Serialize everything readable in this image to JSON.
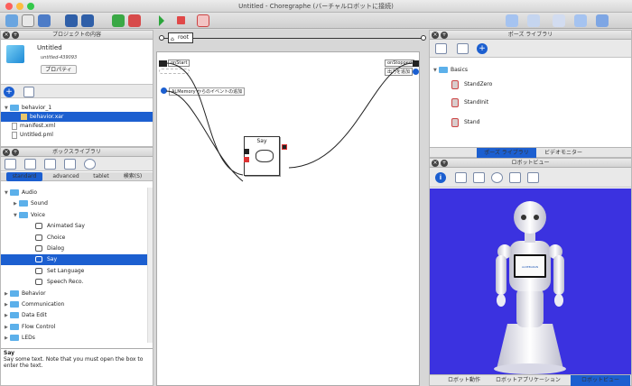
{
  "window": {
    "title": "Untitled - Choregraphe (バーチャルロボットに接続)"
  },
  "project": {
    "header": "プロジェクトの内容",
    "name": "Untitled",
    "id": "untitled-439093",
    "properties_button": "プロパティ",
    "files": [
      "behavior_1",
      "behavior.xar",
      "manifest.xml",
      "Untitled.pml"
    ]
  },
  "library": {
    "header": "ボックスライブラリ",
    "tabs": [
      "standard",
      "advanced",
      "tablet",
      "検索(S)"
    ],
    "items": [
      {
        "label": "Audio",
        "level": 0,
        "open": true
      },
      {
        "label": "Sound",
        "level": 1,
        "open": false
      },
      {
        "label": "Voice",
        "level": 1,
        "open": true
      },
      {
        "label": "Animated Say",
        "level": 2,
        "box": true
      },
      {
        "label": "Choice",
        "level": 2,
        "box": true
      },
      {
        "label": "Dialog",
        "level": 2,
        "box": true
      },
      {
        "label": "Say",
        "level": 2,
        "box": true,
        "selected": true
      },
      {
        "label": "Set Language",
        "level": 2,
        "box": true
      },
      {
        "label": "Speech Reco.",
        "level": 2,
        "box": true
      },
      {
        "label": "Behavior",
        "level": 0,
        "open": false
      },
      {
        "label": "Communication",
        "level": 0,
        "open": false
      },
      {
        "label": "Data Edit",
        "level": 0,
        "open": false
      },
      {
        "label": "Flow Control",
        "level": 0,
        "open": false
      },
      {
        "label": "LEDs",
        "level": 0,
        "open": false
      }
    ],
    "description_title": "Say",
    "description": "Say some text. Note that you must open the box to enter the text."
  },
  "flow": {
    "root_label": "root",
    "on_start": "onStart",
    "on_stopped": "onStopped",
    "memory_event": "ALMemory からのイベントの追加",
    "output_label": "出力を追加",
    "box_title": "Say"
  },
  "poses": {
    "header": "ポーズ ライブラリ",
    "folder": "Basics",
    "items": [
      "StandZero",
      "StandInit",
      "Stand"
    ],
    "tabs": [
      "ポーズ ライブラリ",
      "ビデオモニター"
    ]
  },
  "robot": {
    "header": "ロボットビュー",
    "tablet_text": "ALDEBARAN",
    "tabs": [
      "ロボット動作",
      "ロボットアプリケーション",
      "ロボットビュー"
    ]
  },
  "colors": {
    "selection": "#1c5fd0",
    "viewport": "#3b32e0",
    "accent": "#2a7be0"
  }
}
